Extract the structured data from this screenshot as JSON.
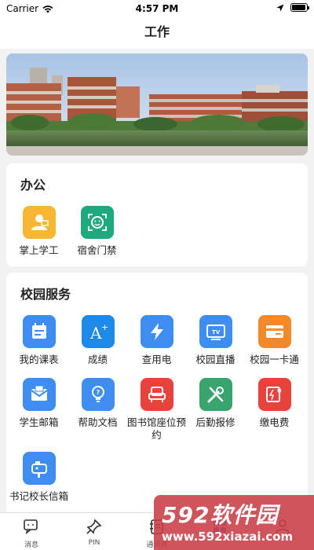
{
  "status_bar": {
    "carrier": "Carrier",
    "time": "4:57 PM",
    "battery_level": 0.95
  },
  "nav": {
    "title": "工作"
  },
  "office": {
    "title": "办公",
    "items": [
      {
        "label": "掌上学工",
        "icon": "student-icon",
        "color": "#f7b733"
      },
      {
        "label": "宿舍门禁",
        "icon": "face-scan-icon",
        "color": "#1faa7e"
      }
    ]
  },
  "campus": {
    "title": "校园服务",
    "items": [
      {
        "label": "我的课表",
        "icon": "schedule-icon",
        "color": "#3d8ef0"
      },
      {
        "label": "成绩",
        "icon": "grade-icon",
        "color": "#1e8ae8"
      },
      {
        "label": "查用电",
        "icon": "lightning-icon",
        "color": "#3d8ef0"
      },
      {
        "label": "校园直播",
        "icon": "tv-icon",
        "color": "#3d8ef0"
      },
      {
        "label": "校园一卡通",
        "icon": "card-icon",
        "color": "#f08a2c"
      },
      {
        "label": "学生邮箱",
        "icon": "mail-icon",
        "color": "#3d8ef0"
      },
      {
        "label": "帮助文档",
        "icon": "bulb-icon",
        "color": "#3d8ef0"
      },
      {
        "label": "图书馆座位预约",
        "icon": "seat-icon",
        "color": "#e8423c"
      },
      {
        "label": "后勤报修",
        "icon": "tools-icon",
        "color": "#3aa46e"
      },
      {
        "label": "缴电费",
        "icon": "pay-icon",
        "color": "#e8423c"
      },
      {
        "label": "书记校长信箱",
        "icon": "mailbox-icon",
        "color": "#3d8ef0"
      }
    ]
  },
  "tabbar": {
    "items": [
      {
        "label": "消息",
        "icon": "chat-icon"
      },
      {
        "label": "PIN",
        "icon": "pin-icon"
      },
      {
        "label": "通讯录",
        "icon": "contacts-icon"
      },
      {
        "label": "",
        "icon": "work-icon"
      },
      {
        "label": "",
        "icon": "profile-icon"
      }
    ]
  },
  "watermark": {
    "main": "592软件园",
    "sub": "www.592xiazai.com"
  }
}
